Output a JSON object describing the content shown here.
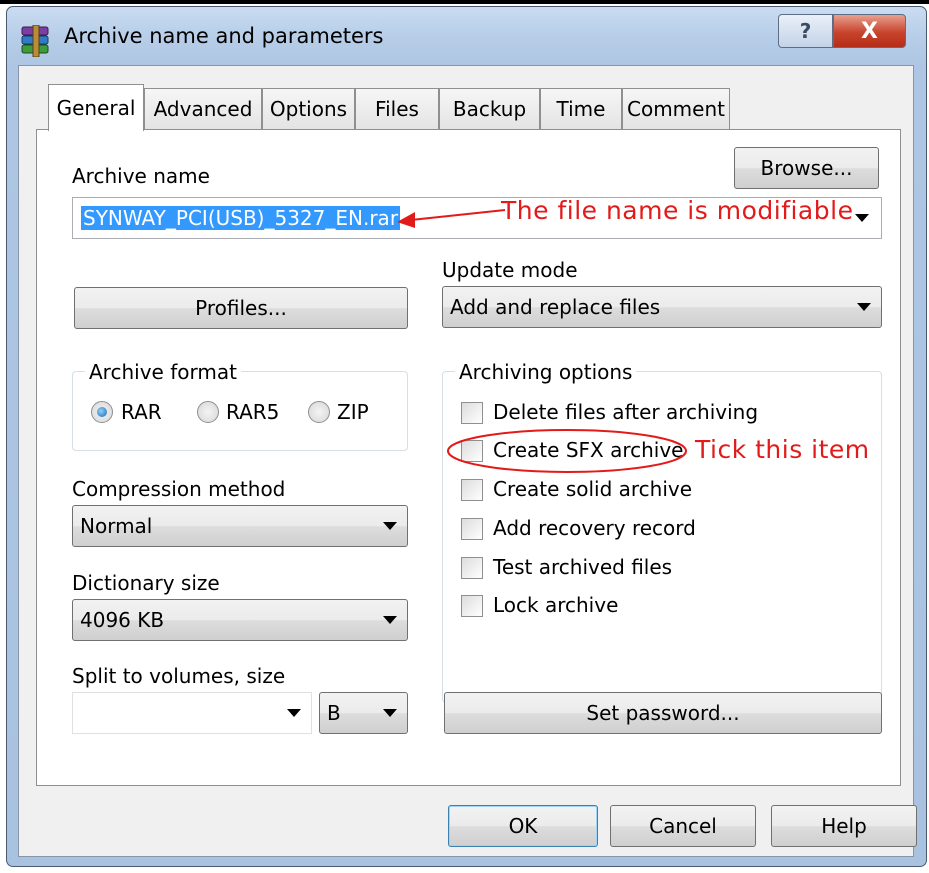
{
  "window": {
    "title": "Archive name and parameters",
    "help_glyph": "?",
    "close_glyph": "X"
  },
  "tabs": [
    {
      "label": "General",
      "active": true
    },
    {
      "label": "Advanced"
    },
    {
      "label": "Options"
    },
    {
      "label": "Files"
    },
    {
      "label": "Backup"
    },
    {
      "label": "Time"
    },
    {
      "label": "Comment"
    }
  ],
  "archive_name": {
    "label": "Archive name",
    "value": "SYNWAY_PCI(USB)_5327_EN.rar",
    "browse_button": "Browse..."
  },
  "update_mode": {
    "label": "Update mode",
    "value": "Add and replace files"
  },
  "profiles_button": "Profiles...",
  "archive_format": {
    "title": "Archive format",
    "options": [
      {
        "label": "RAR",
        "selected": true
      },
      {
        "label": "RAR5",
        "selected": false
      },
      {
        "label": "ZIP",
        "selected": false
      }
    ]
  },
  "compression_method": {
    "label": "Compression method",
    "value": "Normal"
  },
  "dictionary_size": {
    "label": "Dictionary size",
    "value": "4096 KB"
  },
  "split_volumes": {
    "label": "Split to volumes, size",
    "value": "",
    "unit": "B"
  },
  "archiving_options": {
    "title": "Archiving options",
    "items": [
      {
        "label": "Delete files after archiving",
        "checked": false
      },
      {
        "label": "Create SFX archive",
        "checked": false
      },
      {
        "label": "Create solid archive",
        "checked": false
      },
      {
        "label": "Add recovery record",
        "checked": false
      },
      {
        "label": "Test archived files",
        "checked": false
      },
      {
        "label": "Lock archive",
        "checked": false
      }
    ]
  },
  "set_password_button": "Set password...",
  "footer": {
    "ok": "OK",
    "cancel": "Cancel",
    "help": "Help"
  },
  "annotations": {
    "filename_note": "The file name is modifiable",
    "sfx_note": "Tick  this  item",
    "color": "#e21a1a"
  }
}
